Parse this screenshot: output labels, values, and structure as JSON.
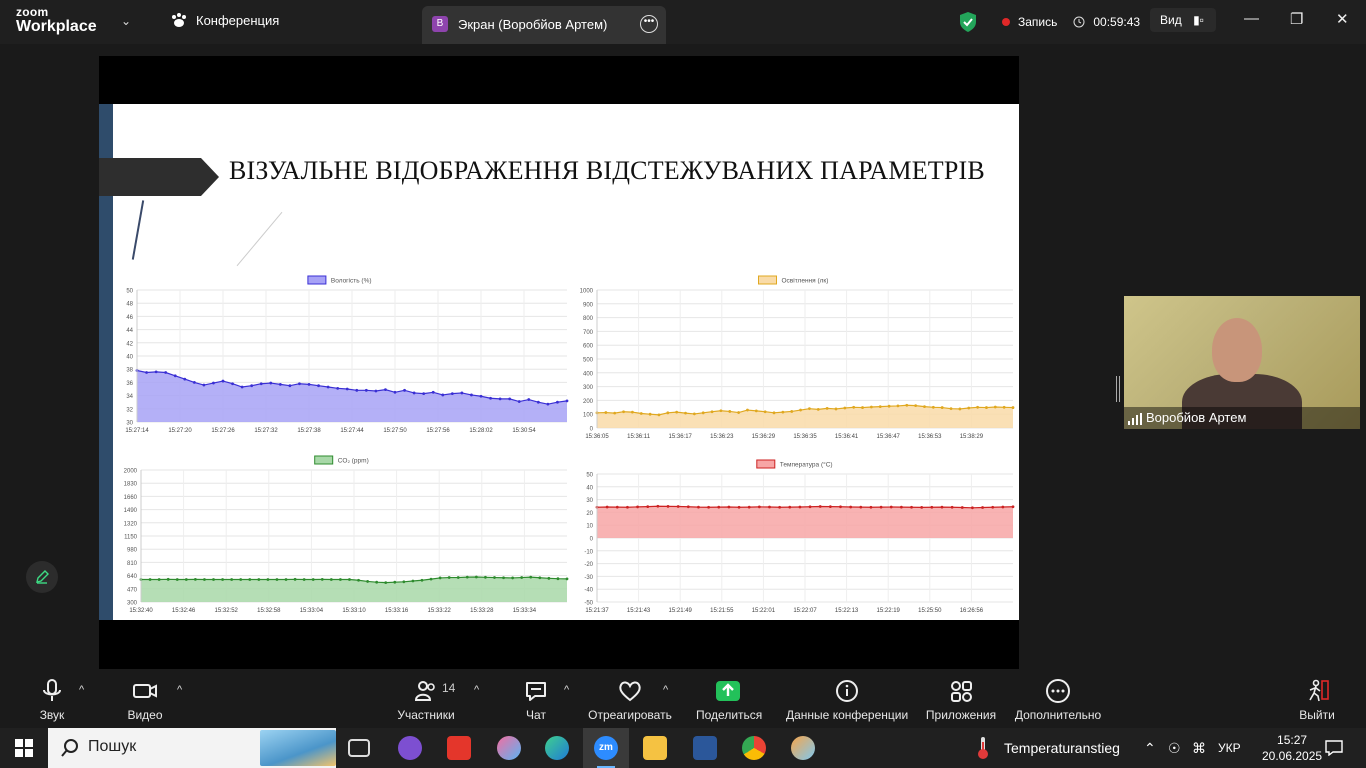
{
  "app": {
    "brand_top": "zoom",
    "brand_bottom": "Workplace"
  },
  "header": {
    "conference_tab": "Конференция",
    "share_badge": "В",
    "share_title": "Экран (Воробйов Артем)",
    "record_label": "Запись",
    "timer": "00:59:43",
    "view_label": "Вид"
  },
  "slide": {
    "title": "ВІЗУАЛЬНЕ ВІДОБРАЖЕННЯ ВІДСТЕЖУВАНИХ ПАРАМЕТРІВ"
  },
  "chart_data": [
    {
      "type": "area",
      "series_name": "Вологість (%)",
      "color": "#3a2fd4",
      "fill": "#a7a2f6",
      "y_ticks": [
        30,
        32,
        34,
        36,
        38,
        40,
        42,
        44,
        46,
        48,
        50
      ],
      "ylim": [
        30,
        50
      ],
      "x_labels": [
        "15:27:14",
        "15:27:20",
        "15:27:26",
        "15:27:32",
        "15:27:38",
        "15:27:44",
        "15:27:50",
        "15:27:56",
        "15:28:02",
        "15:30:54"
      ],
      "values": [
        37.8,
        37.5,
        37.6,
        37.5,
        37.0,
        36.5,
        36.0,
        35.6,
        35.9,
        36.2,
        35.8,
        35.3,
        35.5,
        35.8,
        35.9,
        35.7,
        35.5,
        35.8,
        35.7,
        35.5,
        35.3,
        35.1,
        35.0,
        34.8,
        34.8,
        34.7,
        34.9,
        34.5,
        34.8,
        34.4,
        34.3,
        34.5,
        34.1,
        34.3,
        34.4,
        34.1,
        33.9,
        33.6,
        33.5,
        33.5,
        33.1,
        33.4,
        33.0,
        32.7,
        33.0,
        33.2
      ],
      "title": ""
    },
    {
      "type": "area",
      "series_name": "Освітлення (лк)",
      "color": "#e0a820",
      "fill": "#f9dba8",
      "y_ticks": [
        0,
        100,
        200,
        300,
        400,
        500,
        600,
        700,
        800,
        900,
        1000
      ],
      "ylim": [
        0,
        1000
      ],
      "x_labels": [
        "15:36:05",
        "15:36:11",
        "15:36:17",
        "15:36:23",
        "15:36:29",
        "15:36:35",
        "15:36:41",
        "15:36:47",
        "15:36:53",
        "15:38:29"
      ],
      "values": [
        110,
        112,
        108,
        118,
        115,
        105,
        100,
        95,
        110,
        115,
        108,
        102,
        110,
        118,
        125,
        120,
        112,
        130,
        124,
        118,
        110,
        115,
        120,
        130,
        140,
        135,
        142,
        138,
        145,
        150,
        148,
        152,
        155,
        158,
        160,
        165,
        162,
        155,
        150,
        148,
        140,
        138,
        145,
        150,
        148,
        152,
        150,
        148
      ],
      "title": ""
    },
    {
      "type": "area",
      "series_name": "CO₂ (ppm)",
      "color": "#2e8b2e",
      "fill": "#a8d8a8",
      "y_ticks": [
        300,
        470,
        640,
        810,
        980,
        1150,
        1320,
        1490,
        1660,
        1830,
        2000
      ],
      "ylim": [
        300,
        2000
      ],
      "x_labels": [
        "15:32:40",
        "15:32:46",
        "15:32:52",
        "15:32:58",
        "15:33:04",
        "15:33:10",
        "15:33:16",
        "15:33:22",
        "15:33:28",
        "15:33:34"
      ],
      "values": [
        590,
        590,
        590,
        592,
        590,
        590,
        591,
        590,
        590,
        590,
        590,
        590,
        590,
        590,
        590,
        590,
        590,
        592,
        590,
        590,
        591,
        590,
        590,
        590,
        580,
        565,
        555,
        550,
        555,
        560,
        570,
        580,
        595,
        610,
        615,
        615,
        620,
        622,
        618,
        615,
        612,
        610,
        615,
        620,
        612,
        605,
        600,
        598
      ],
      "title": ""
    },
    {
      "type": "area",
      "series_name": "Температура (°C)",
      "color": "#cc2222",
      "fill": "#f7a6a6",
      "y_ticks": [
        -50,
        -40,
        -30,
        -20,
        -10,
        0,
        10,
        20,
        30,
        40,
        50
      ],
      "ylim": [
        -50,
        50
      ],
      "x_labels": [
        "15:21:37",
        "15:21:43",
        "15:21:49",
        "15:21:55",
        "15:22:01",
        "15:22:07",
        "15:22:13",
        "15:22:19",
        "15:25:50",
        "16:26:56"
      ],
      "values": [
        24.0,
        24.2,
        24.1,
        24.0,
        24.3,
        24.5,
        24.8,
        24.7,
        24.6,
        24.4,
        24.1,
        24.0,
        24.1,
        24.2,
        24.0,
        24.1,
        24.3,
        24.2,
        24.0,
        24.1,
        24.2,
        24.4,
        24.6,
        24.5,
        24.4,
        24.2,
        24.1,
        24.0,
        24.1,
        24.2,
        24.1,
        24.0,
        23.9,
        24.0,
        24.1,
        24.0,
        23.8,
        23.6,
        23.8,
        24.0,
        24.2,
        24.4
      ],
      "title": ""
    }
  ],
  "selfview": {
    "name": "Воробйов Артем"
  },
  "toolbar": {
    "audio": "Звук",
    "video": "Видео",
    "participants": "Участники",
    "participants_count": "14",
    "chat": "Чат",
    "react": "Отреагировать",
    "share": "Поделиться",
    "info": "Данные конференции",
    "apps": "Приложения",
    "more": "Дополнительно",
    "leave": "Выйти"
  },
  "taskbar": {
    "search": "Пошук",
    "weather": "Temperaturanstieg",
    "lang": "УКР",
    "time": "15:27",
    "date": "20.06.2025"
  }
}
